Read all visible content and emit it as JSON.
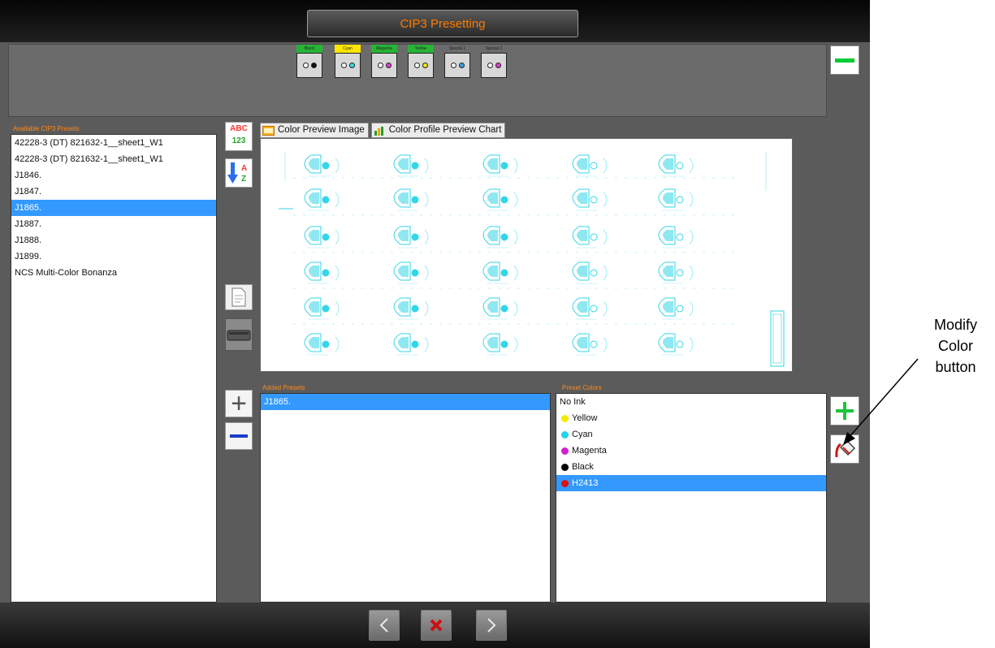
{
  "window": {
    "title": "CIP3 Presetting"
  },
  "units": [
    {
      "label": "Black",
      "head_color": "#27b436",
      "ink": "#111111"
    },
    {
      "label": "Cyan",
      "head_color": "#ffe600",
      "ink": "#33dde6"
    },
    {
      "label": "Magenta",
      "head_color": "#27b436",
      "ink": "#e23cd8"
    },
    {
      "label": "Yellow",
      "head_color": "#27b436",
      "ink": "#f2e800"
    },
    {
      "label": "Special 1",
      "head_color": "#6b6b6b",
      "ink": "#3aa0e0"
    },
    {
      "label": "Special 2",
      "head_color": "#6b6b6b",
      "ink": "#e23cd8"
    }
  ],
  "available": {
    "caption": "Available CIP3 Presets",
    "items": [
      "42228-3 (DT) 821632-1__sheet1_W1",
      "42228-3 (DT) 821632-1__sheet1_W1",
      "J1846.",
      "J1847.",
      "J1865.",
      "J1887.",
      "J1888.",
      "J1899.",
      "NCS Multi-Color Bonanza"
    ],
    "selected_index": 4
  },
  "sort": {
    "abc": "ABC",
    "num": "123",
    "az_a": "A",
    "az_z": "Z"
  },
  "tabs": [
    {
      "label": "Color Preview Image",
      "icon": "image-icon"
    },
    {
      "label": "Color Profile Preview Chart",
      "icon": "bar-chart-icon"
    }
  ],
  "added": {
    "caption": "Added Presets",
    "items": [
      "J1865."
    ]
  },
  "preset_colors": {
    "caption": "Preset Colors",
    "items": [
      {
        "label": "No Ink",
        "color": ""
      },
      {
        "label": "Yellow",
        "color": "#f5e800"
      },
      {
        "label": "Cyan",
        "color": "#22d3ee"
      },
      {
        "label": "Magenta",
        "color": "#d020d0"
      },
      {
        "label": "Black",
        "color": "#000000"
      },
      {
        "label": "H2413",
        "color": "#e01010"
      }
    ],
    "selected_index": 5
  },
  "annotation": {
    "line1": "Modify",
    "line2": "Color",
    "line3": "button"
  },
  "colors": {
    "accent": "#3399ff",
    "title": "#ff7a00",
    "preview_ink": "#33d6e6"
  }
}
